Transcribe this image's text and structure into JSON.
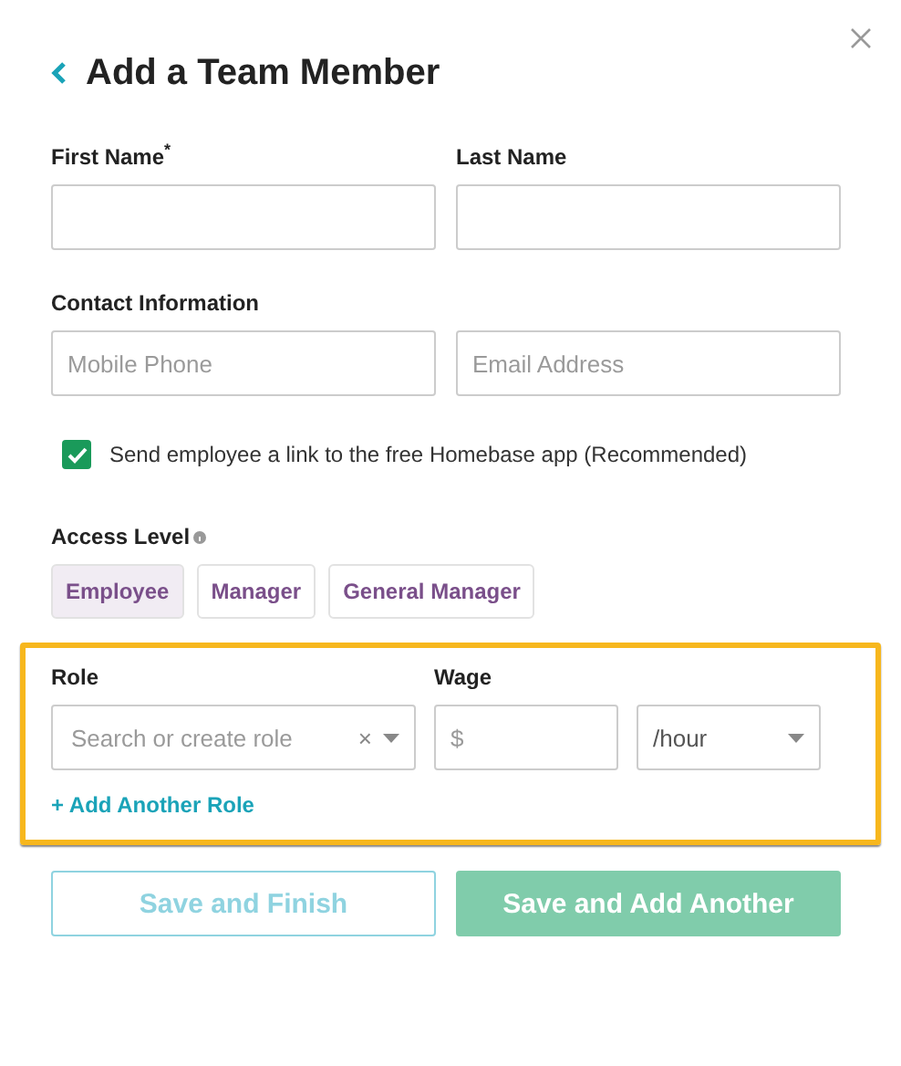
{
  "dialog": {
    "title": "Add a Team Member"
  },
  "name_fields": [
    {
      "label": "First Name$^{*}$"
    },
    {
      "label": "Last Name"
    }
  ],
  "contact": {
    "label": "Contact Information",
    "fields": [
      {
        "placeholder": "Mobile Phone"
      },
      {
        "placeholder": "Email Address"
      }
    ]
  },
  "send_link": {
    "label": "Send employee a link to the free Homebase app (Recommended)",
    "checked": true
  },
  "access_level": {
    "label": "Access Level",
    "options": [
      {
        "label": "Employee",
        "selected": true
      },
      {
        "label": "Manager",
        "selected": false
      },
      {
        "label": "General Manager",
        "selected": false
      }
    ]
  },
  "roles": {
    "highlighted": true,
    "role_label": "Role",
    "wage_label": "Wage",
    "role_placeholder": "Search or create role",
    "clear_symbol": "×",
    "wage_placeholder": "$",
    "period": "/hour",
    "add_link": "+ Add Another Role"
  },
  "buttons": [
    {
      "label": "Save and Finish",
      "kind": "outline"
    },
    {
      "label": "Save and Add Another",
      "kind": "primary"
    }
  ]
}
